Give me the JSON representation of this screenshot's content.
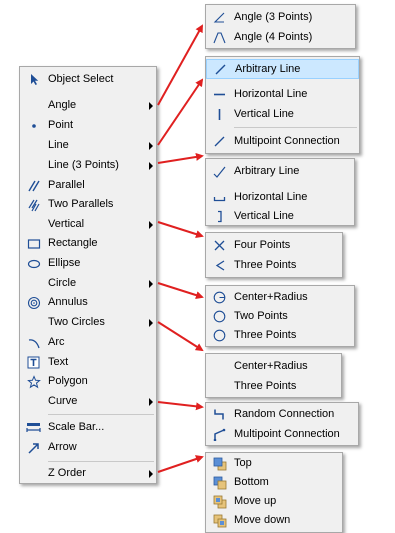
{
  "main_menu": {
    "items": [
      {
        "label": "Object Select",
        "icon": "cursor-arrow-icon"
      },
      {
        "label": "Angle",
        "submenu": true
      },
      {
        "label": "Point",
        "icon": "dot-icon"
      },
      {
        "label": "Line",
        "submenu": true
      },
      {
        "label": "Line (3 Points)",
        "submenu": true
      },
      {
        "label": "Parallel",
        "icon": "parallel-lines-icon"
      },
      {
        "label": "Two Parallels",
        "icon": "two-parallels-icon"
      },
      {
        "label": "Vertical",
        "submenu": true
      },
      {
        "label": "Rectangle",
        "icon": "rectangle-icon"
      },
      {
        "label": "Ellipse",
        "icon": "ellipse-icon"
      },
      {
        "label": "Circle",
        "submenu": true
      },
      {
        "label": "Annulus",
        "icon": "annulus-icon"
      },
      {
        "label": "Two Circles",
        "submenu": true
      },
      {
        "label": "Arc",
        "icon": "arc-icon"
      },
      {
        "label": "Text",
        "icon": "text-icon"
      },
      {
        "label": "Polygon",
        "icon": "polygon-icon"
      },
      {
        "label": "Curve",
        "submenu": true
      },
      {
        "label": "Scale Bar...",
        "icon": "scale-bar-icon"
      },
      {
        "label": "Arrow",
        "icon": "arrow-icon"
      },
      {
        "label": "Z Order",
        "submenu": true
      }
    ]
  },
  "submenus": {
    "angle": [
      "Angle (3 Points)",
      "Angle (4 Points)"
    ],
    "line": [
      "Arbitrary Line",
      "Horizontal Line",
      "Vertical Line",
      "Multipoint Connection"
    ],
    "line3": [
      "Arbitrary Line",
      "Horizontal Line",
      "Vertical Line"
    ],
    "vertical": [
      "Four Points",
      "Three Points"
    ],
    "circle": [
      "Center+Radius",
      "Two Points",
      "Three Points"
    ],
    "two_circles": [
      "Center+Radius",
      "Three Points"
    ],
    "curve": [
      "Random Connection",
      "Multipoint Connection"
    ],
    "zorder": [
      "Top",
      "Bottom",
      "Move up",
      "Move down"
    ]
  },
  "colors": {
    "menu_bg": "#f0f0f0",
    "highlight": "#cce8ff",
    "icon_blue": "#1f4e96",
    "arrow_red": "#e02020"
  }
}
